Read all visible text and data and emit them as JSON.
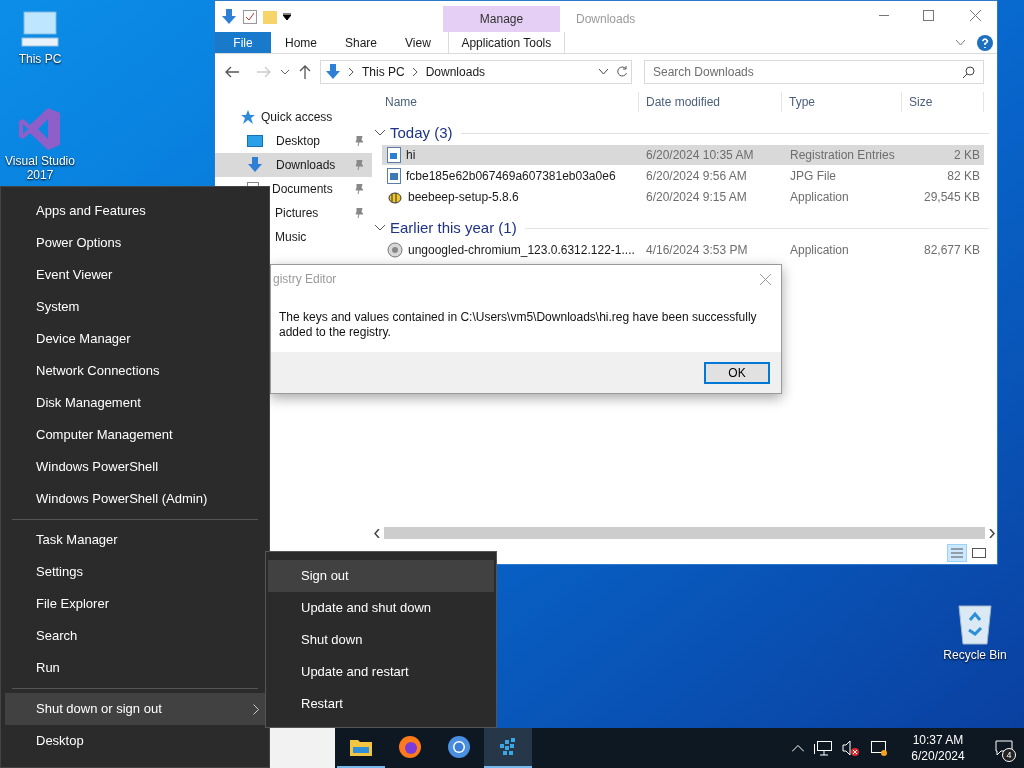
{
  "desktop_icons": [
    {
      "label": "This PC",
      "kind": "pc"
    },
    {
      "label": "Visual Studio 2017",
      "kind": "vs"
    },
    {
      "label": "Recycle Bin",
      "kind": "bin"
    }
  ],
  "explorer": {
    "title": "Downloads",
    "contextual_header": "Manage",
    "tabs": [
      {
        "label": "File",
        "kind": "file"
      },
      {
        "label": "Home",
        "kind": "plain"
      },
      {
        "label": "Share",
        "kind": "plain"
      },
      {
        "label": "View",
        "kind": "plain"
      },
      {
        "label": "Application Tools",
        "kind": "contextual"
      }
    ],
    "address": [
      "This PC",
      "Downloads"
    ],
    "search": {
      "placeholder": "Search Downloads"
    },
    "columns": [
      "Name",
      "Date modified",
      "Type",
      "Size"
    ],
    "nav": [
      {
        "label": "Quick access",
        "kind": "star",
        "pinned": false,
        "selected": false
      },
      {
        "label": "Desktop",
        "kind": "desktop",
        "pinned": true,
        "selected": false
      },
      {
        "label": "Downloads",
        "kind": "download",
        "pinned": true,
        "selected": true
      },
      {
        "label": "Documents",
        "kind": "document",
        "pinned": true,
        "selected": false
      },
      {
        "label": "Pictures",
        "pinned": true,
        "selected": false
      },
      {
        "label": "Music",
        "pinned": false,
        "selected": false
      }
    ],
    "groups": [
      {
        "title": "Today (3)",
        "files": [
          {
            "name": "hi",
            "date": "6/20/2024 10:35 AM",
            "type": "Registration Entries",
            "size": "2 KB",
            "kind": "reg",
            "selected": true
          },
          {
            "name": "fcbe185e62b067469a607381eb03a0e6",
            "date": "6/20/2024 9:56 AM",
            "type": "JPG File",
            "size": "82 KB",
            "kind": "jpg",
            "selected": false
          },
          {
            "name": "beebeep-setup-5.8.6",
            "date": "6/20/2024 9:15 AM",
            "type": "Application",
            "size": "29,545 KB",
            "kind": "setup",
            "selected": false
          }
        ]
      },
      {
        "title": "Earlier this year (1)",
        "files": [
          {
            "name": "ungoogled-chromium_123.0.6312.122-1....",
            "date": "4/16/2024 3:53 PM",
            "type": "Application",
            "size": "82,677 KB",
            "kind": "app",
            "selected": false
          }
        ]
      }
    ]
  },
  "dialog": {
    "title": "gistry Editor",
    "message": "The keys and values contained in C:\\Users\\vm5\\Downloads\\hi.reg have been successfully added to the registry.",
    "button": "OK"
  },
  "power_menu": {
    "sections": [
      {
        "items": [
          {
            "label": "Apps and Features",
            "kind": "item",
            "selected": false
          },
          {
            "label": "Power Options",
            "kind": "item",
            "selected": false
          },
          {
            "label": "Event Viewer",
            "kind": "item",
            "selected": false
          },
          {
            "label": "System",
            "kind": "item",
            "selected": false
          },
          {
            "label": "Device Manager",
            "kind": "item",
            "selected": false
          },
          {
            "label": "Network Connections",
            "kind": "item",
            "selected": false
          },
          {
            "label": "Disk Management",
            "kind": "item",
            "selected": false
          },
          {
            "label": "Computer Management",
            "kind": "item",
            "selected": false
          },
          {
            "label": "Windows PowerShell",
            "kind": "item",
            "selected": false
          },
          {
            "label": "Windows PowerShell (Admin)",
            "kind": "item",
            "selected": false
          }
        ]
      },
      {
        "items": [
          {
            "label": "Task Manager",
            "kind": "item",
            "selected": false
          },
          {
            "label": "Settings",
            "kind": "item",
            "selected": false
          },
          {
            "label": "File Explorer",
            "kind": "item",
            "selected": false
          },
          {
            "label": "Search",
            "kind": "item",
            "selected": false
          },
          {
            "label": "Run",
            "kind": "item",
            "selected": false
          }
        ]
      },
      {
        "items": [
          {
            "label": "Shut down or sign out",
            "kind": "submenu",
            "selected": true
          },
          {
            "label": "Desktop",
            "kind": "item",
            "selected": false
          }
        ]
      }
    ]
  },
  "submenu": {
    "items": [
      {
        "label": "Sign out",
        "selected": true
      },
      {
        "label": "Update and shut down",
        "selected": false
      },
      {
        "label": "Shut down",
        "selected": false
      },
      {
        "label": "Update and restart",
        "selected": false
      },
      {
        "label": "Restart",
        "selected": false
      }
    ]
  },
  "taskbar": {
    "apps": [
      {
        "kind": "folder",
        "active": false,
        "running": true
      },
      {
        "kind": "firefox",
        "active": false,
        "running": false
      },
      {
        "kind": "chromium",
        "active": false,
        "running": false
      },
      {
        "kind": "cubes",
        "active": true,
        "running": true
      }
    ],
    "time": "10:37 AM",
    "date": "6/20/2024",
    "notifications": "4"
  }
}
